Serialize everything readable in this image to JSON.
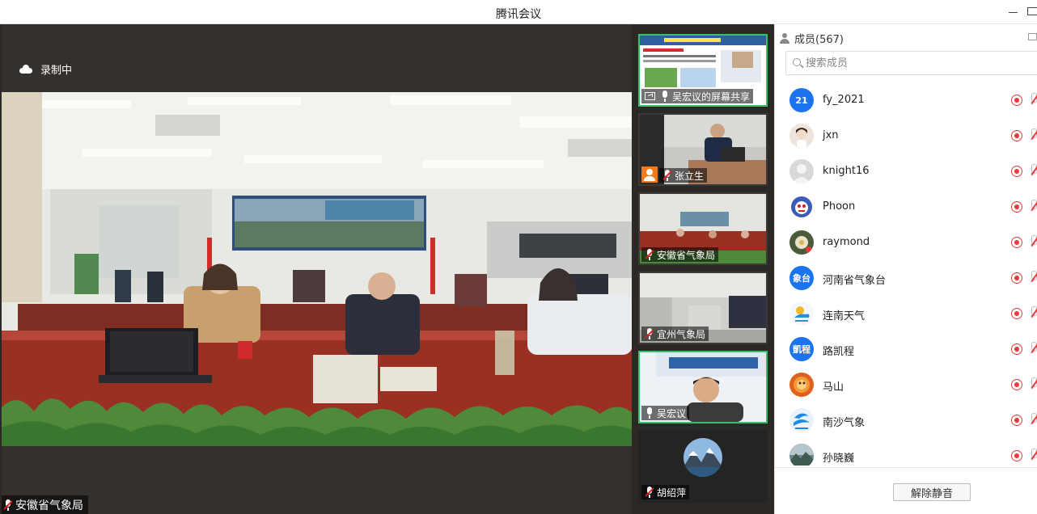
{
  "window": {
    "title": "腾讯会议"
  },
  "recording": {
    "label": "录制中"
  },
  "main_video": {
    "speaker": "安徽省气象局"
  },
  "thumbnails": [
    {
      "label": "吴宏议的屏幕共享",
      "icon": "screen-share-icon",
      "active": true
    },
    {
      "label": "张立生",
      "icon": "host-icon",
      "muted": true,
      "active": false
    },
    {
      "label": "安徽省气象局",
      "muted": true,
      "active": false
    },
    {
      "label": "宜州气象局",
      "muted": true,
      "active": false
    },
    {
      "label": "吴宏议",
      "active": true
    },
    {
      "label": "胡绍萍",
      "muted": true,
      "active": false
    }
  ],
  "panel": {
    "members_title": "成员(567)",
    "search_placeholder": "搜索成员",
    "unmute_label": "解除静音"
  },
  "members": [
    {
      "name": "fy_2021",
      "avatar_text": "21",
      "avatar_color": "#1b73f0"
    },
    {
      "name": "jxn",
      "avatar_text": "",
      "avatar_color": "#efe4dc"
    },
    {
      "name": "knight16",
      "avatar_text": "",
      "avatar_color": "#d8d8d8"
    },
    {
      "name": "Phoon",
      "avatar_text": "",
      "avatar_color": "#3b5bb8"
    },
    {
      "name": "raymond",
      "avatar_text": "",
      "avatar_color": "#4a5a3c"
    },
    {
      "name": "河南省气象台",
      "avatar_text": "象台",
      "avatar_color": "#1b73f0"
    },
    {
      "name": "连南天气",
      "avatar_text": "",
      "avatar_color": "#f4f8fc"
    },
    {
      "name": "路凯程",
      "avatar_text": "凱程",
      "avatar_color": "#1b73f0"
    },
    {
      "name": "马山",
      "avatar_text": "",
      "avatar_color": "#e0611c"
    },
    {
      "name": "南沙气象",
      "avatar_text": "",
      "avatar_color": "#eaf3fb"
    },
    {
      "name": "孙晓巍",
      "avatar_text": "",
      "avatar_color": "#6f8590"
    }
  ]
}
